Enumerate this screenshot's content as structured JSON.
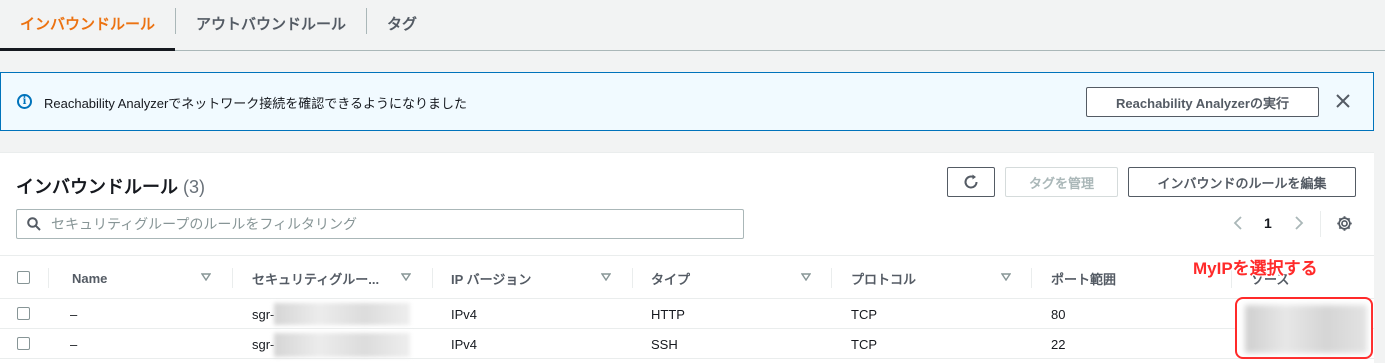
{
  "tabs": [
    {
      "label": "インバウンドルール",
      "active": true
    },
    {
      "label": "アウトバウンドルール",
      "active": false
    },
    {
      "label": "タグ",
      "active": false
    }
  ],
  "banner": {
    "text": "Reachability Analyzerでネットワーク接続を確認できるようになりました",
    "button": "Reachability Analyzerの実行"
  },
  "panel": {
    "title": "インバウンドルール",
    "count": "(3)",
    "manage_tags_button": "タグを管理",
    "edit_rules_button": "インバウンドのルールを編集",
    "search_placeholder": "セキュリティグループのルールをフィルタリング",
    "page_number": "1"
  },
  "table": {
    "columns": [
      "Name",
      "セキュリティグルー...",
      "IP バージョン",
      "タイプ",
      "プロトコル",
      "ポート範囲",
      "ソース"
    ],
    "rows": [
      {
        "name": "–",
        "sg": "sgr-",
        "ip": "IPv4",
        "type": "HTTP",
        "protocol": "TCP",
        "port": "80"
      },
      {
        "name": "–",
        "sg": "sgr-",
        "ip": "IPv4",
        "type": "SSH",
        "protocol": "TCP",
        "port": "22"
      }
    ]
  },
  "annotation": {
    "text": "MyIPを選択する"
  },
  "colors": {
    "accent": "#ec7211",
    "link": "#0073bb",
    "annotation": "#ff2a2a"
  }
}
